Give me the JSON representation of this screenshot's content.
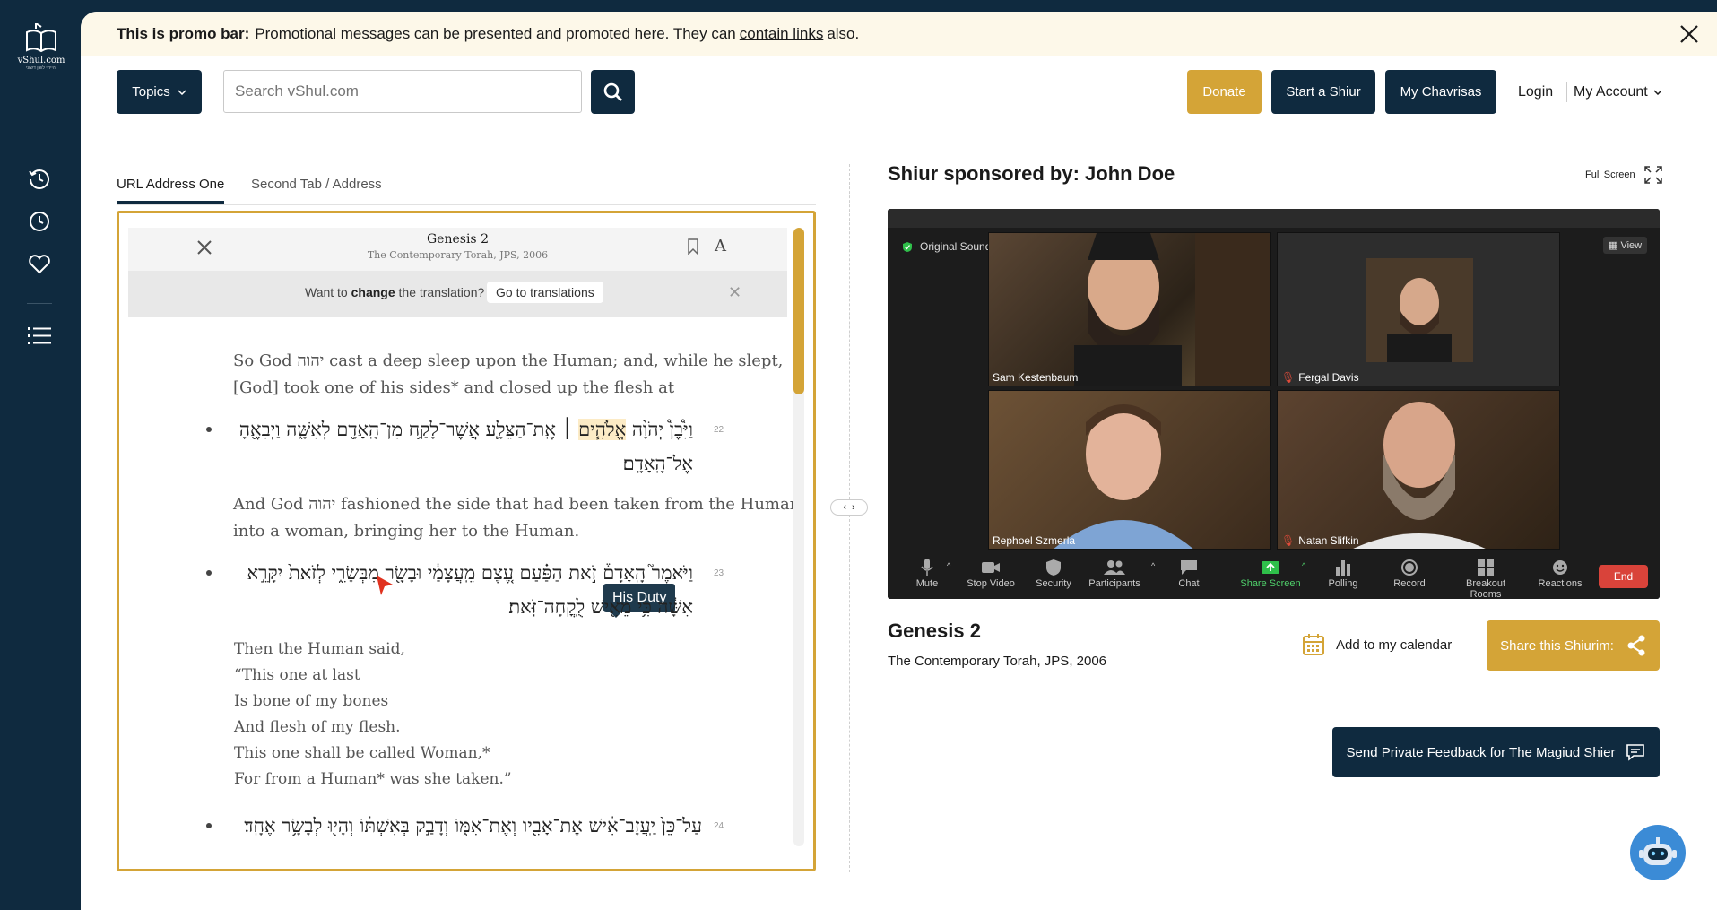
{
  "logo": {
    "name": "vShul.com",
    "tagline": "והייתי לשון דשוני"
  },
  "promo": {
    "bold": "This is promo bar:",
    "text_before": "Promotional messages can be presented and promoted here. They can",
    "link": "contain links",
    "text_after": "also."
  },
  "header": {
    "topics_label": "Topics",
    "search_placeholder": "Search vShul.com",
    "donate_label": "Donate",
    "start_label": "Start a Shiur",
    "chavrisas_label": "My Chavrisas",
    "login_label": "Login",
    "account_label": "My Account"
  },
  "tabs": [
    {
      "label": "URL Address One",
      "active": true
    },
    {
      "label": "Second Tab / Address",
      "active": false
    }
  ],
  "reader": {
    "title": "Genesis 2",
    "subtitle": "The Contemporary Torah, JPS, 2006",
    "change_prefix": "Want to",
    "change_bold": "change",
    "change_suffix": "the translation?",
    "go_translations": "Go to translations",
    "tooltip": "His Duty",
    "p1_l1": "So God יהוה cast a deep sleep upon the Human; and, while he slept,",
    "p1_l2": "[God] took one of his sides* and closed up the flesh at",
    "v22_num": "22",
    "v22_l1_pre": "וַיִּ֩בֶן֩ יְהֹוָ֨ה",
    "v22_hl": "אֱלֹהִ֧ים",
    "v22_l1_post": "׀ אֶֽת־הַצֵּלָ֛ע אֲשֶׁר־לָקַ֥ח מִן־הָֽאָדָ֖ם לְאִשָּׁ֑ה וַיְבִאֶ֖הָ",
    "v22_l2": "אֶל־הָֽאָדָֽם׃",
    "p2_l1": "And God יהוה fashioned the side that had been taken from the Human",
    "p2_l2": "into a woman, bringing her to the Human.",
    "v23_num": "23",
    "v23_l1": "וַיֹּאמֶר֮ הָֽאָדָם֒ זֹ֣את הַפַּ֗עַם עֶ֚צֶם מֵֽעֲצָמַ֔י וּבָשָׂ֖ר מִבְּשָׂרִ֑י לְזֹאת֙ יִקָּרֵ֣א",
    "v23_l2": "אִשָּׁ֔ה כִּ֥י מֵאִ֖ישׁ לֻֽקֳחָה־זֹּֽאת׃",
    "poem": [
      "Then the Human said,",
      "“This one at last",
      "Is bone of my bones",
      "And flesh of my flesh.",
      "This one shall be called Woman,*",
      "For from a Human* was she taken.”"
    ],
    "v24_num": "24",
    "v24_l1": "עַל־כֵּן֙ יַֽעֲזָב־אִ֔ישׁ אֶת־אָבִ֖יו וְאֶת־אִמּ֑וֹ וְדָבַ֣ק בְּאִשְׁתּ֔וֹ וְהָי֖וּ לְבָשָׂ֥ר אֶחָֽד׃",
    "progress": 0.27
  },
  "shiur": {
    "sponsor": "Shiur sponsored by:  John Doe",
    "fullscreen": "Full Screen",
    "title": "Genesis 2",
    "subtitle": "The Contemporary Torah, JPS, 2006",
    "calendar": "Add to my calendar",
    "share": "Share this Shiurim:",
    "feedback": "Send Private Feedback for The Magiud Shier"
  },
  "video": {
    "original_sound": "Original Sound: Off",
    "view": "View",
    "participants": [
      {
        "name": "Sam Kestenbaum",
        "muted": false
      },
      {
        "name": "Fergal Davis",
        "muted": true
      },
      {
        "name": "Rephoel Szmerla",
        "muted": false
      },
      {
        "name": "Natan Slifkin",
        "muted": true
      }
    ],
    "controls": {
      "mute": "Mute",
      "stop_video": "Stop Video",
      "security": "Security",
      "participants": "Participants",
      "chat": "Chat",
      "share_screen": "Share Screen",
      "polling": "Polling",
      "record": "Record",
      "breakout": "Breakout Rooms",
      "reactions": "Reactions",
      "end": "End"
    }
  },
  "colors": {
    "navy": "#0f2a3f",
    "gold": "#d4a437",
    "promo_bg": "#fdf8e9"
  }
}
